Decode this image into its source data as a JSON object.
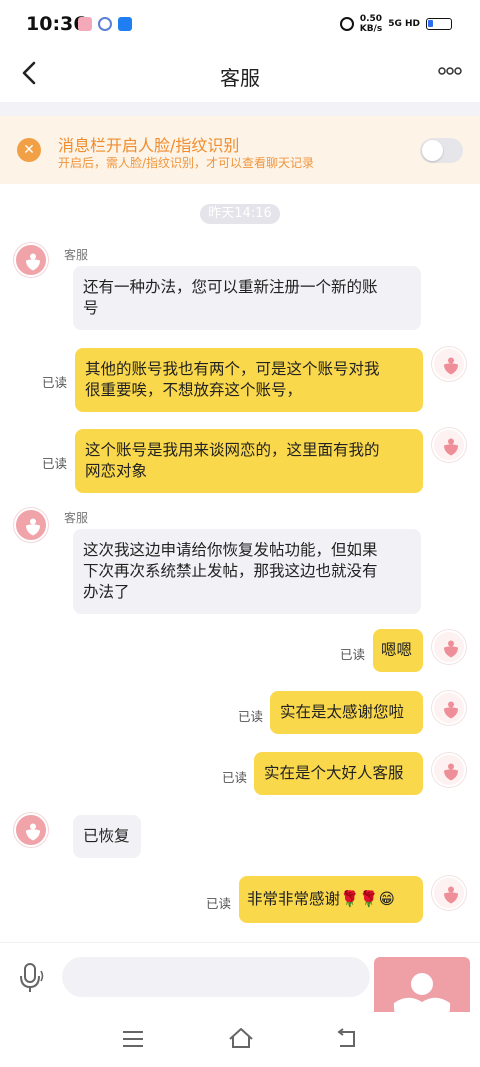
{
  "status_bar": {
    "time": "10:36",
    "net_speed_value": "0.50",
    "net_speed_unit": "KB/s",
    "network": "5G HD",
    "app_icons": [
      "app-icon-pink",
      "app-icon-blue-circle",
      "zhihu-icon"
    ]
  },
  "header": {
    "title": "客服"
  },
  "notice": {
    "title": "消息栏开启人脸/指纹识别",
    "subtitle": "开启后，需人脸/指纹识别，才可以查看聊天记录",
    "toggle_on": false
  },
  "chat": {
    "timestamp": "昨天14:16",
    "read_label": "已读",
    "messages": [
      {
        "side": "left",
        "sender": "客服",
        "text_line1": "还有一种办法，您可以重新注册一个新的账",
        "text_line2": "号"
      },
      {
        "side": "right",
        "read": "已读",
        "text_line1": "其他的账号我也有两个，可是这个账号对我",
        "text_line2": "很重要唉，不想放弃这个账号，"
      },
      {
        "side": "right",
        "read": "已读",
        "text_line1": "这个账号是我用来谈网恋的，这里面有我的",
        "text_line2": "网恋对象"
      },
      {
        "side": "left",
        "sender": "客服",
        "text_line1": "这次我这边申请给你恢复发帖功能，但如果",
        "text_line2": "下次再次系统禁止发帖，那我这边也就没有",
        "text_line3": "办法了"
      },
      {
        "side": "right",
        "read": "已读",
        "text": "嗯嗯"
      },
      {
        "side": "right",
        "read": "已读",
        "text": "实在是太感谢您啦"
      },
      {
        "side": "right",
        "read": "已读",
        "text": "实在是个大好人客服"
      },
      {
        "side": "left",
        "text": "已恢复"
      },
      {
        "side": "right",
        "read": "已读",
        "text": "非常非常感谢🌹🌹😁"
      }
    ]
  },
  "input": {
    "placeholder": ""
  },
  "colors": {
    "accent_yellow": "#fad84c",
    "brand_pink": "#ef9fa6",
    "notice_orange": "#ef8d2e"
  }
}
